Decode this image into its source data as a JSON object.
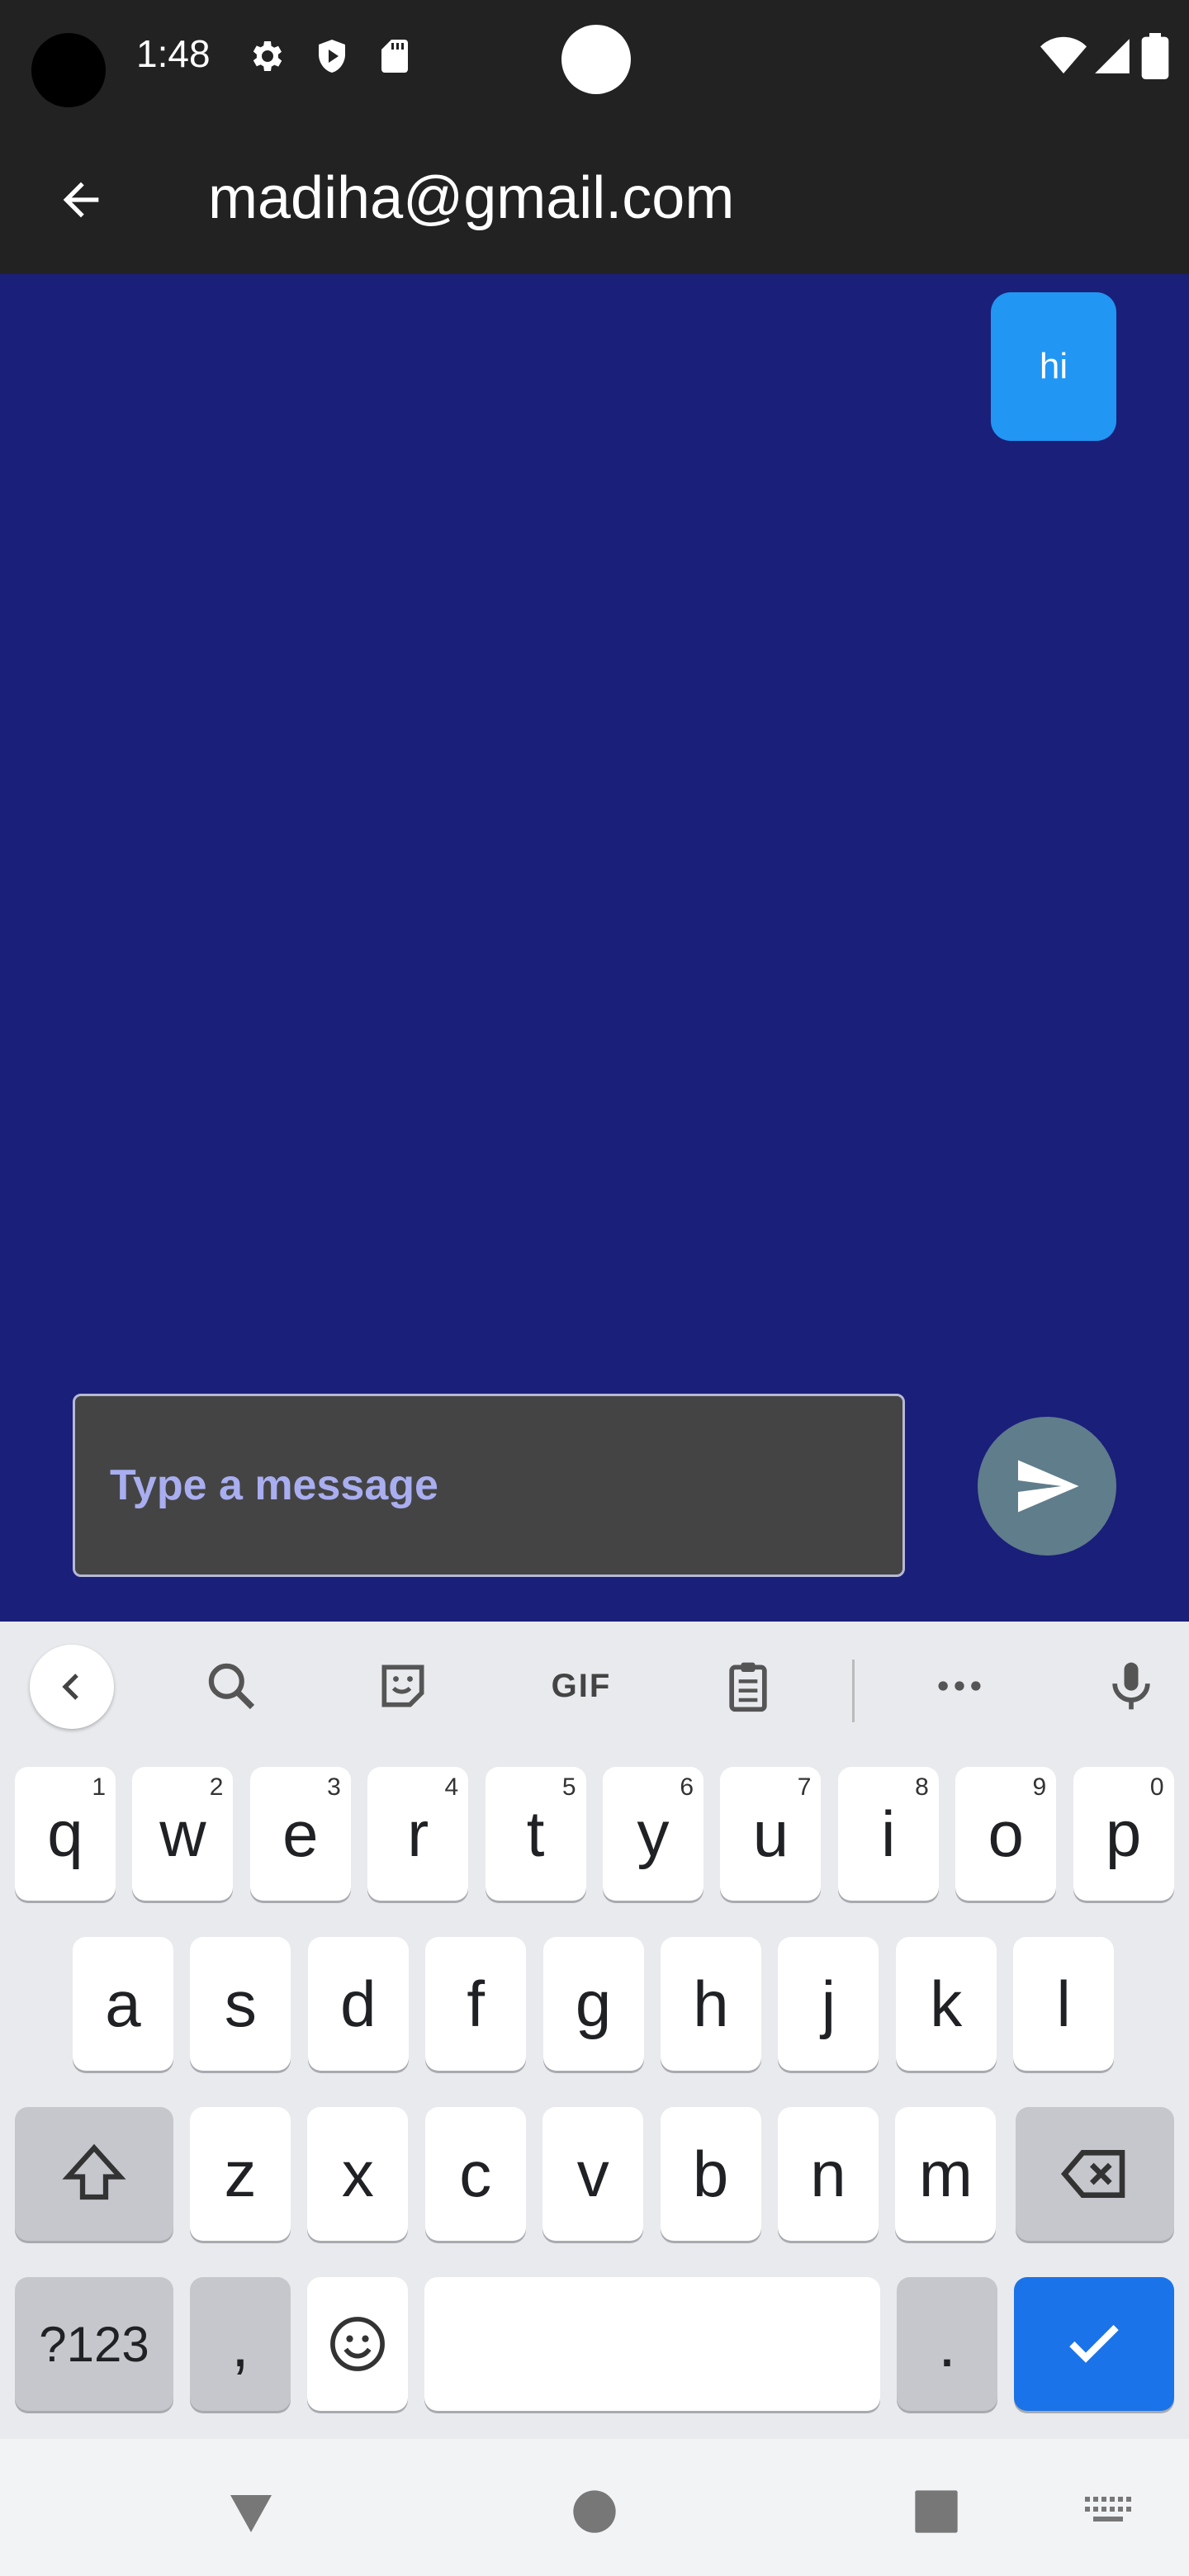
{
  "status_bar": {
    "time": "1:48",
    "icons": [
      "settings-icon",
      "shield-icon",
      "sd-card-icon",
      "wifi-icon",
      "signal-icon",
      "battery-icon"
    ]
  },
  "app_bar": {
    "title": "madiha@gmail.com",
    "back_icon": "arrow-back-icon"
  },
  "chat": {
    "messages": [
      {
        "text": "hi",
        "sender": "me"
      }
    ],
    "input_placeholder": "Type a message",
    "input_value": "",
    "send_icon": "send-icon"
  },
  "keyboard": {
    "toolbar": {
      "gif_label": "GIF",
      "icons": [
        "chevron-left-icon",
        "search-icon",
        "sticker-icon",
        "gif-icon",
        "clipboard-icon",
        "more-icon",
        "mic-icon"
      ]
    },
    "row1": [
      {
        "k": "q",
        "h": "1"
      },
      {
        "k": "w",
        "h": "2"
      },
      {
        "k": "e",
        "h": "3"
      },
      {
        "k": "r",
        "h": "4"
      },
      {
        "k": "t",
        "h": "5"
      },
      {
        "k": "y",
        "h": "6"
      },
      {
        "k": "u",
        "h": "7"
      },
      {
        "k": "i",
        "h": "8"
      },
      {
        "k": "o",
        "h": "9"
      },
      {
        "k": "p",
        "h": "0"
      }
    ],
    "row2": [
      "a",
      "s",
      "d",
      "f",
      "g",
      "h",
      "j",
      "k",
      "l"
    ],
    "row3": [
      "z",
      "x",
      "c",
      "v",
      "b",
      "n",
      "m"
    ],
    "symbols_label": "?123",
    "comma_label": ",",
    "period_label": "."
  },
  "colors": {
    "chat_background": "#1a1f7a",
    "bubble": "#2196f3",
    "send_button": "#607d8b",
    "app_bar": "#222222",
    "keyboard_action": "#1a73e8"
  }
}
